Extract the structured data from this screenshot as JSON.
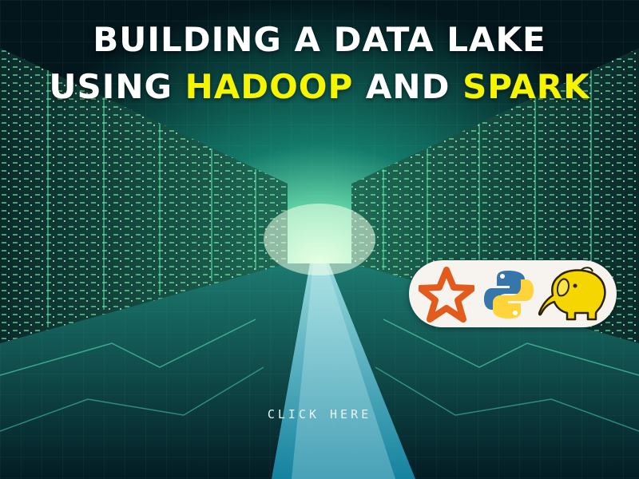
{
  "title": {
    "line1": "BUILDING A DATA LAKE",
    "line2_part1": "USING ",
    "line2_highlight1": "HADOOP",
    "line2_part2": " AND ",
    "line2_highlight2": "SPARK"
  },
  "cta": {
    "label": "CLICK HERE"
  },
  "logos": [
    "spark-icon",
    "python-icon",
    "hadoop-elephant-icon"
  ],
  "colors": {
    "highlight": "#f5f500",
    "title": "#ffffff",
    "pill": "#f7f3ee",
    "spark": "#e25a1c",
    "python_blue": "#3776ab",
    "python_yellow": "#ffd43b",
    "hadoop": "#f6d600"
  }
}
